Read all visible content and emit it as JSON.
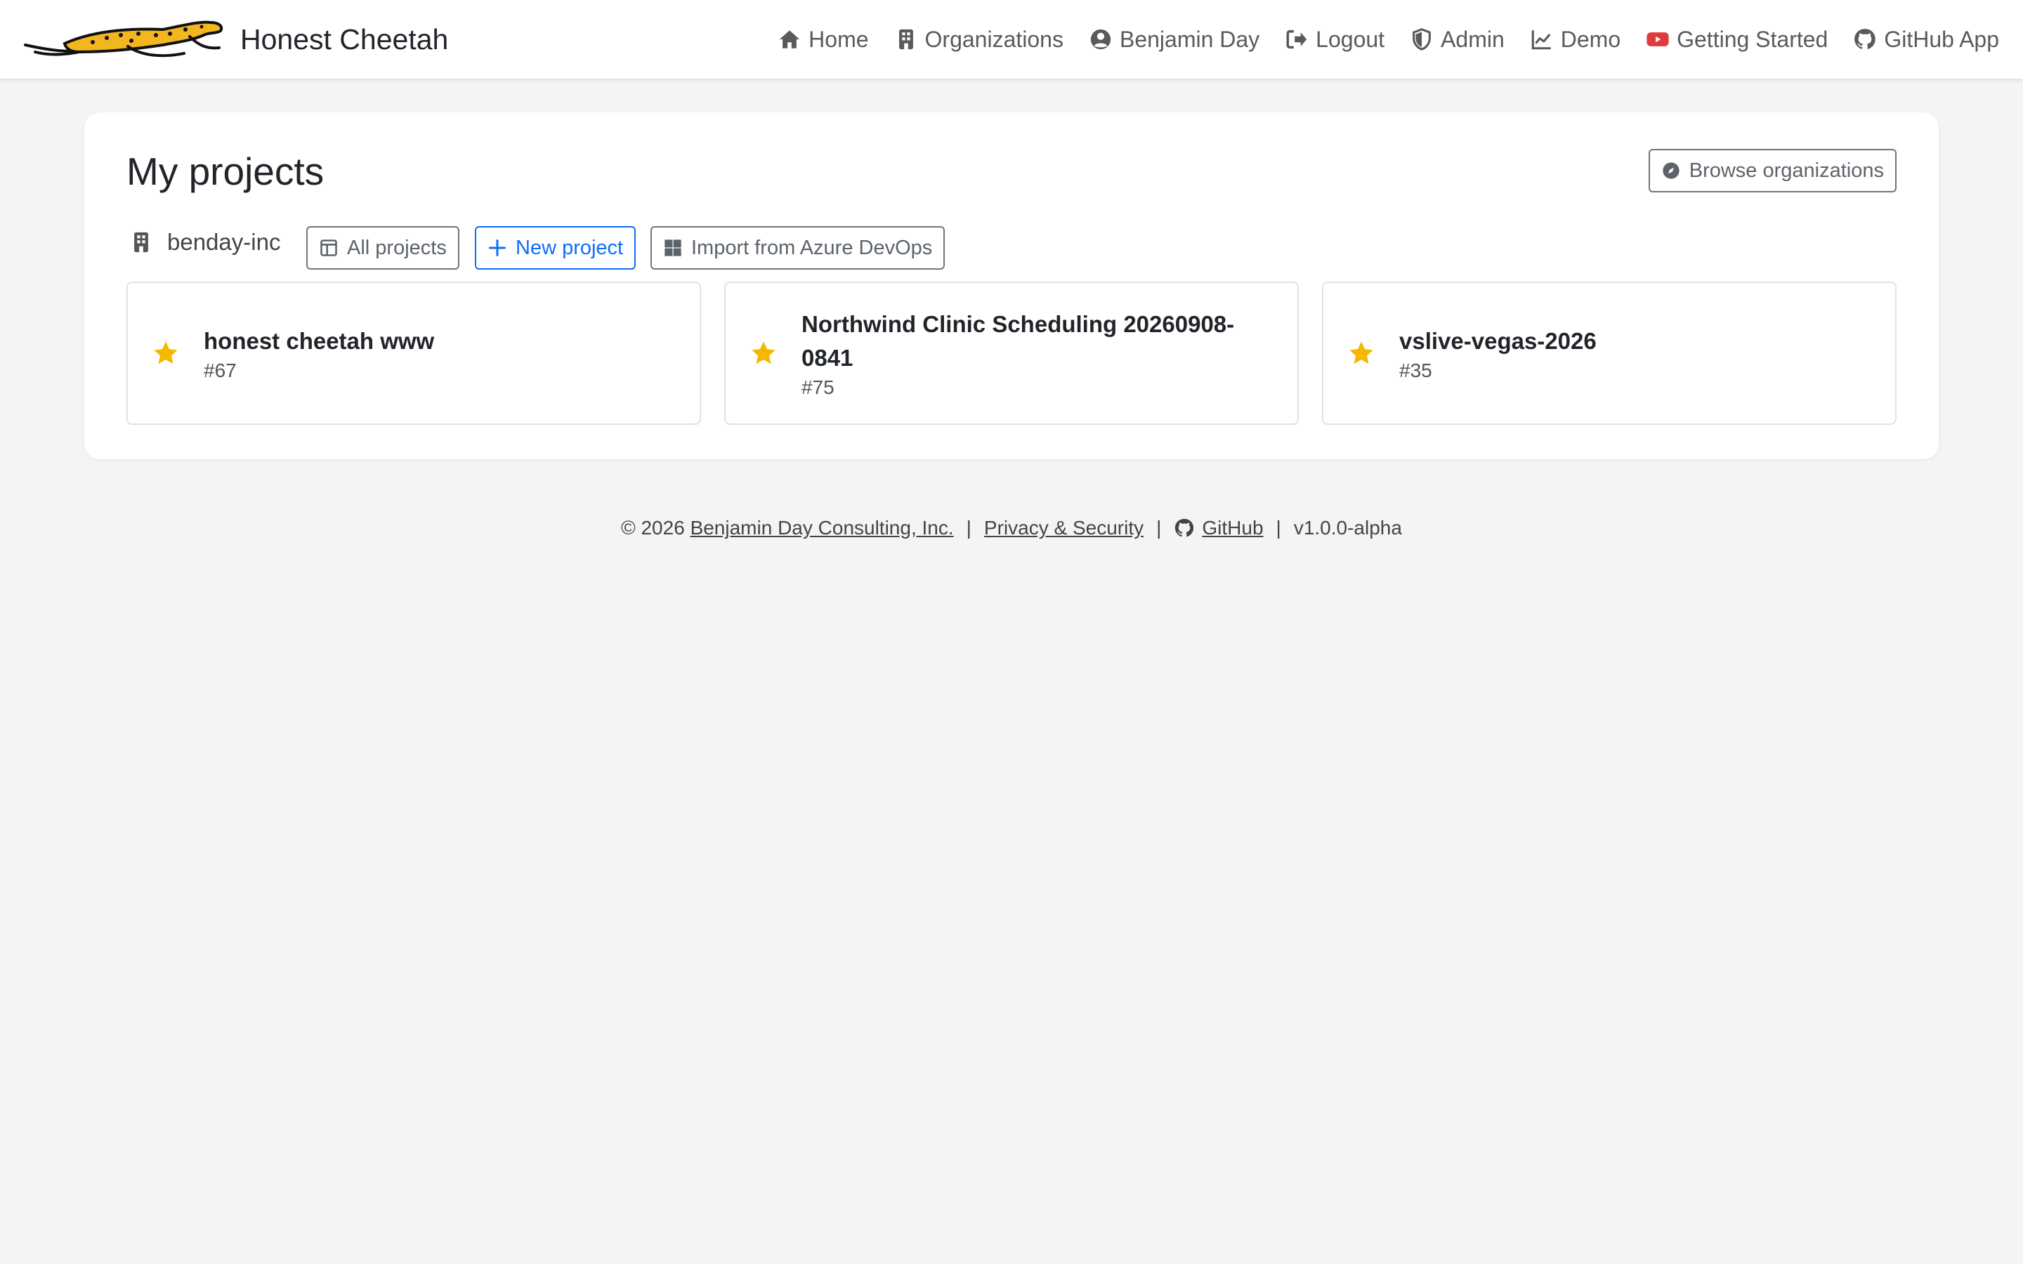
{
  "navbar": {
    "brand": "Honest Cheetah",
    "items": [
      {
        "label": "Home",
        "icon": "home-icon"
      },
      {
        "label": "Organizations",
        "icon": "building-icon"
      },
      {
        "label": "Benjamin Day",
        "icon": "user-circle-icon"
      },
      {
        "label": "Logout",
        "icon": "logout-icon"
      },
      {
        "label": "Admin",
        "icon": "shield-icon"
      },
      {
        "label": "Demo",
        "icon": "chart-line-icon"
      },
      {
        "label": "Getting Started",
        "icon": "youtube-icon"
      },
      {
        "label": "GitHub App",
        "icon": "github-icon"
      }
    ]
  },
  "main": {
    "title": "My projects",
    "browse_label": "Browse organizations",
    "org_name": "benday-inc",
    "all_projects_label": "All projects",
    "new_project_label": "New project",
    "import_label": "Import from Azure DevOps",
    "projects": [
      {
        "name": "honest cheetah www",
        "number": "#67",
        "starred": true
      },
      {
        "name": "Northwind Clinic Scheduling 20260908-0841",
        "number": "#75",
        "starred": true
      },
      {
        "name": "vslive-vegas-2026",
        "number": "#35",
        "starred": true
      }
    ]
  },
  "footer": {
    "copyright": "© 2026",
    "company_link": "Benjamin Day Consulting, Inc.",
    "sep": "|",
    "privacy_link": "Privacy & Security",
    "github_link": "GitHub",
    "version": "v1.0.0-alpha"
  },
  "colors": {
    "primary": "#0d6efd",
    "star": "#f5b800",
    "background": "#f4f4f4",
    "youtube": "#e0393e"
  }
}
